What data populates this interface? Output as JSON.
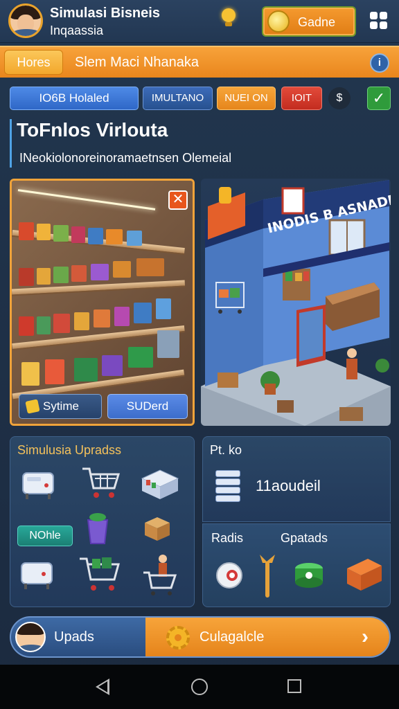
{
  "header": {
    "title": "Simulasi Bisneis",
    "subtitle": "Inqaassia",
    "coin_button_label": "Gadne",
    "icons": [
      "avatar",
      "lightbulb-icon",
      "coin-icon",
      "menu-grid-icon"
    ]
  },
  "tabbar": {
    "home_label": "Hores",
    "title": "Slem Maci Nhanaka",
    "info_label": "i"
  },
  "filters": {
    "chip1": "IO6B Holaled",
    "chip2": "IMULTANO",
    "chip3": "NUEI ON",
    "chip4": "IOIT",
    "dollar": "$",
    "check": "✓"
  },
  "main": {
    "heading": "ToFnlos Virlouta",
    "subheading": "INeokiolonoreinoramaetnsen Olemeial"
  },
  "shelf_panel": {
    "close_label": "✕",
    "system_button": "Sytime",
    "stored_button": "SUDerd"
  },
  "store_panel": {
    "sign_text": "INODIS B ASNADE!"
  },
  "upgrades_panel": {
    "title": "Simulusia Upradss",
    "nohle_label": "NOhle"
  },
  "info_panel": {
    "label": "Pt. ko",
    "value": "11aoudeil"
  },
  "radis_panel": {
    "left_label": "Radis",
    "right_label": "Gpatads"
  },
  "bottom_bar": {
    "left_label": "Upads",
    "right_label": "Culagalcle",
    "chevron": "›"
  },
  "colors": {
    "accent_orange": "#f29a2e",
    "panel_blue": "#2b4766",
    "chip_blue": "#3f79d8",
    "chip_red": "#d43a2b",
    "chip_green": "#2f9b3b"
  }
}
